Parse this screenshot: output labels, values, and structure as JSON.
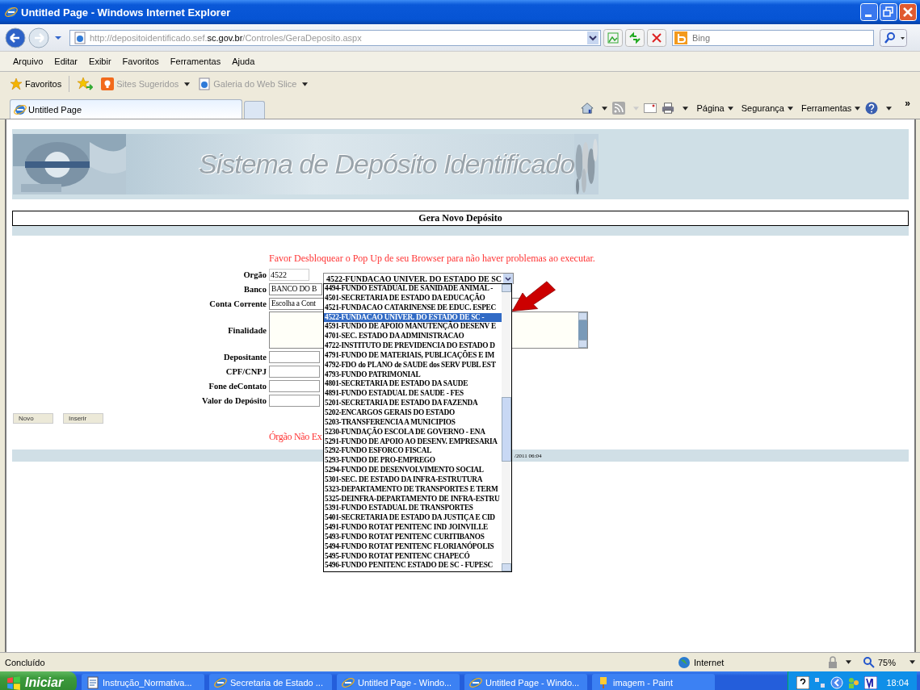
{
  "window": {
    "title": "Untitled Page - Windows Internet Explorer"
  },
  "address": {
    "url_start": "http://depositoidentificado.sef.",
    "url_domain": "sc.gov.br",
    "url_end": "/Controles/GeraDeposito.aspx"
  },
  "search": {
    "placeholder": "Bing"
  },
  "menu": [
    "Arquivo",
    "Editar",
    "Exibir",
    "Favoritos",
    "Ferramentas",
    "Ajuda"
  ],
  "favorites_bar": {
    "label": "Favoritos",
    "links": [
      "Sites Sugeridos",
      "Galeria do Web Slice"
    ]
  },
  "tabs": [
    {
      "label": "Untitled Page",
      "selected": true
    }
  ],
  "command_bar": {
    "menus": [
      "Página",
      "Segurança",
      "Ferramentas"
    ],
    "more": "»"
  },
  "page": {
    "banner_title": "Sistema de Depósito Identificado",
    "heading": "Gera Novo Depósito",
    "notice": "Favor Desbloquear o Pop Up de seu Browser para não haver problemas ao executar.",
    "fields": [
      {
        "label": "Orgão",
        "kind": "input",
        "value": "4522"
      },
      {
        "label": "Banco",
        "kind": "select",
        "value": "BANCO DO B"
      },
      {
        "label": "Conta Corrente",
        "kind": "select",
        "value": "Escolha a Cont"
      },
      {
        "label": "Finalidade",
        "kind": "textarea"
      },
      {
        "label": "Depositante",
        "kind": "input"
      },
      {
        "label": "CPF/CNPJ",
        "kind": "input"
      },
      {
        "label": "Fone deContato",
        "kind": "input"
      },
      {
        "label": "Valor do Depósito",
        "kind": "input"
      }
    ],
    "buttons": [
      "Novo",
      "Inserir"
    ],
    "error": "Órgão Não Ex",
    "footer_date": "/2011 06:04"
  },
  "orgao_dropdown": {
    "value": "4522-FUNDACAO UNIVER. DO ESTADO DE SC",
    "options": [
      {
        "label": "4494-FUNDO ESTADUAL DE SANIDADE ANIMAL -",
        "selected": false
      },
      {
        "label": "4501-SECRETARIA DE ESTADO DA EDUCAÇÃO",
        "selected": false
      },
      {
        "label": "4521-FUNDACAO CATARINENSE DE EDUC. ESPEC",
        "selected": false
      },
      {
        "label": "4522-FUNDACAO UNIVER. DO ESTADO DE SC -",
        "selected": true
      },
      {
        "label": "4591-FUNDO DE APOIO MANUTENÇÃO DESENV E",
        "selected": false
      },
      {
        "label": "4701-SEC. ESTADO DA ADMINISTRACAO",
        "selected": false
      },
      {
        "label": "4722-INSTITUTO DE PREVIDENCIA DO ESTADO D",
        "selected": false
      },
      {
        "label": "4791-FUNDO DE MATERIAIS, PUBLICAÇÕES E IM",
        "selected": false
      },
      {
        "label": "4792-FDO do PLANO de SAUDE dos SERV PUBL EST",
        "selected": false
      },
      {
        "label": "4793-FUNDO PATRIMONIAL",
        "selected": false
      },
      {
        "label": "4801-SECRETARIA DE ESTADO DA SAUDE",
        "selected": false
      },
      {
        "label": "4891-FUNDO ESTADUAL DE SAUDE - FES",
        "selected": false
      },
      {
        "label": "5201-SECRETARIA DE ESTADO DA FAZENDA",
        "selected": false
      },
      {
        "label": "5202-ENCARGOS GERAIS DO ESTADO",
        "selected": false
      },
      {
        "label": "5203-TRANSFERENCIA A MUNICIPIOS",
        "selected": false
      },
      {
        "label": "5230-FUNDAÇÃO ESCOLA DE GOVERNO - ENA",
        "selected": false
      },
      {
        "label": "5291-FUNDO DE APOIO AO DESENV. EMPRESARIA",
        "selected": false
      },
      {
        "label": "5292-FUNDO ESFORCO FISCAL",
        "selected": false
      },
      {
        "label": "5293-FUNDO DE PRO-EMPREGO",
        "selected": false
      },
      {
        "label": "5294-FUNDO DE DESENVOLVIMENTO SOCIAL",
        "selected": false
      },
      {
        "label": "5301-SEC. DE ESTADO DA INFRA-ESTRUTURA",
        "selected": false
      },
      {
        "label": "5323-DEPARTAMENTO DE TRANSPORTES E TERM",
        "selected": false
      },
      {
        "label": "5325-DEINFRA-DEPARTAMENTO DE INFRA-ESTRU",
        "selected": false
      },
      {
        "label": "5391-FUNDO ESTADUAL DE TRANSPORTES",
        "selected": false
      },
      {
        "label": "5401-SECRETARIA DE ESTADO DA JUSTIÇA E CID",
        "selected": false
      },
      {
        "label": "5491-FUNDO ROTAT PENITENC IND JOINVILLE",
        "selected": false
      },
      {
        "label": "5493-FUNDO ROTAT PENITENC CURITIBANOS",
        "selected": false
      },
      {
        "label": "5494-FUNDO ROTAT PENITENC FLORIANÓPOLIS",
        "selected": false
      },
      {
        "label": "5495-FUNDO ROTAT PENITENC CHAPECÓ",
        "selected": false
      },
      {
        "label": "5496-FUNDO PENITENC ESTADO DE SC - FUPESC",
        "selected": false
      }
    ]
  },
  "status_bar": {
    "text": "Concluído",
    "zone": "Internet",
    "zoom": "75%"
  },
  "taskbar": {
    "start": "Iniciar",
    "tasks": [
      "Instrução_Normativa...",
      "Secretaria de Estado ...",
      "Untitled Page - Windo...",
      "Untitled Page - Windo...",
      "imagem - Paint"
    ],
    "clock": "18:04"
  }
}
